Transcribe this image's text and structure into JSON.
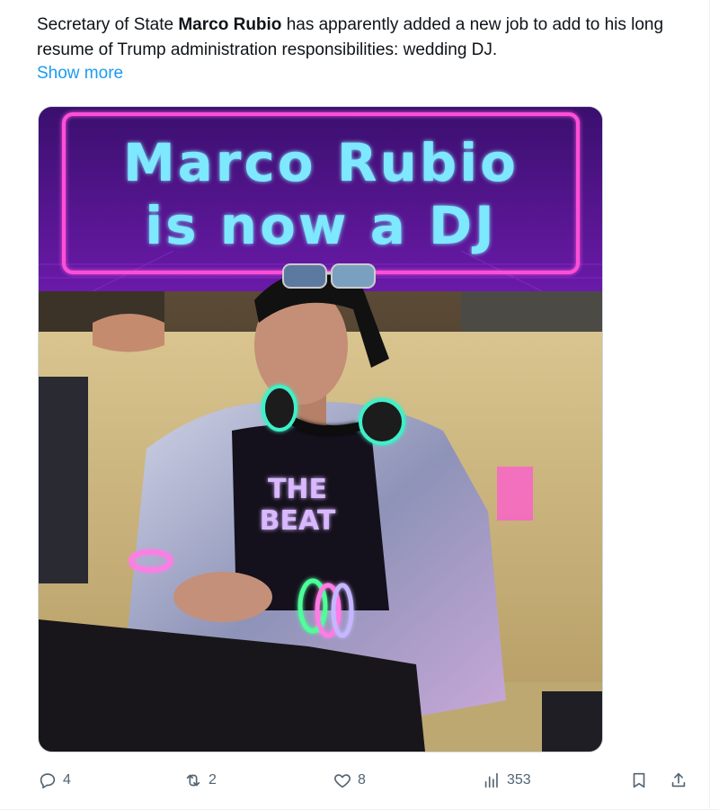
{
  "tweet": {
    "text_prefix": "Secretary of State ",
    "text_bold": "Marco Rubio",
    "text_suffix": " has apparently added a new job to add to his long resume of Trump administration responsibilities: wedding DJ.",
    "show_more": "Show more"
  },
  "media": {
    "banner_line1": "Marco Rubio",
    "banner_line2": "is now a DJ",
    "shirt_line1": "THE",
    "shirt_line2": "BEAT",
    "accent_neon_pink": "#ff4fd8",
    "accent_neon_cyan": "#7ee8ff",
    "banner_bg": "#4a1280"
  },
  "actions": {
    "replies": "4",
    "reposts": "2",
    "likes": "8",
    "views": "353"
  },
  "icons": {
    "reply": "reply-icon",
    "repost": "repost-icon",
    "like": "heart-icon",
    "views": "views-icon",
    "bookmark": "bookmark-icon",
    "share": "share-icon"
  }
}
